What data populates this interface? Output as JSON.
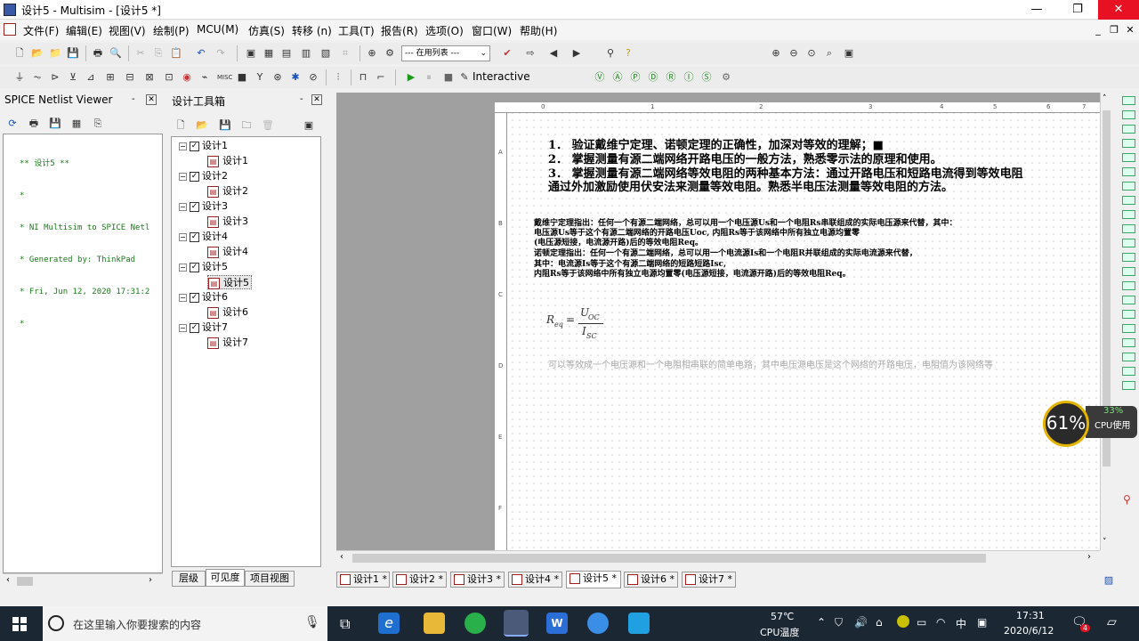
{
  "window": {
    "title": "设计5 - Multisim - [设计5 *]",
    "controls": {
      "minimize": "—",
      "restore": "❐",
      "close": "✕"
    }
  },
  "menu": [
    "文件(F)",
    "编辑(E)",
    "视图(V)",
    "绘制(P)",
    "MCU(M)",
    "仿真(S)",
    "转移 (n)",
    "工具(T)",
    "报告(R)",
    "选项(O)",
    "窗口(W)",
    "帮助(H)"
  ],
  "toolbar": {
    "in_use_list": "--- 在用列表 ---",
    "interactive_label": "Interactive"
  },
  "netlist_viewer": {
    "title": "SPICE Netlist Viewer",
    "lines": [
      "** 设计5 **",
      "*",
      "* NI Multisim to SPICE Netl",
      "* Generated by: ThinkPad",
      "* Fri, Jun 12, 2020 17:31:2",
      "*"
    ]
  },
  "design_toolbox": {
    "title": "设计工具箱",
    "tree": [
      {
        "parent": "设计1",
        "child": "设计1"
      },
      {
        "parent": "设计2",
        "child": "设计2"
      },
      {
        "parent": "设计3",
        "child": "设计3"
      },
      {
        "parent": "设计4",
        "child": "设计4"
      },
      {
        "parent": "设计5",
        "child": "设计5"
      },
      {
        "parent": "设计6",
        "child": "设计6"
      },
      {
        "parent": "设计7",
        "child": "设计7"
      }
    ],
    "tabs": [
      "层级",
      "可见度",
      "项目视图"
    ]
  },
  "sheet": {
    "ruler_top": [
      "0",
      "1",
      "2",
      "3",
      "4",
      "5",
      "6",
      "7"
    ],
    "ruler_left": [
      "A",
      "B",
      "C",
      "D",
      "E",
      "F"
    ],
    "objectives": [
      "1． 验证戴维宁定理、诺顿定理的正确性，加深对等效的理解；■",
      "2． 掌握测量有源二端网络开路电压的一般方法，熟悉零示法的原理和使用。",
      "3． 掌握测量有源二端网络等效电阻的两种基本方法：通过开路电压和短路电流得到等效电阻",
      "通过外加激励使用伏安法来测量等效电阻。熟悉半电压法测量等效电阻的方法。"
    ],
    "theory": [
      "戴维宁定理指出：任何一个有源二端网络，总可以用一个电压源Us和一个电阻Rs串联组成的实际电压源来代替，其中：",
      "电压源Us等于这个有源二端网络的开路电压Uoc, 内阻Rs等于该网络中所有独立电源均置零",
      "(电压源短接，电流源开路)后的等效电阻Req。",
      "诺顿定理指出：任何一个有源二端网络，总可以用一个电流源Is和一个电阻R并联组成的实际电流源来代替，",
      "其中：电流源Is等于这个有源二端网络的短路短路Isc,",
      "内阻Rs等于该网络中所有独立电源均置零(电压源短接，电流源开路)后的等效电阻Req。"
    ],
    "formula": {
      "lhs": "R",
      "lhs_sub": "eq",
      "eq": "=",
      "num": "U",
      "num_sub": "OC",
      "den": "I",
      "den_sub": "SC"
    },
    "faded_note": "可以等效成一个电压源和一个电阻相串联的简单电路，其中电压源电压是这个网络的开路电压，电阻值为该网络等"
  },
  "doc_tabs": [
    "设计1 *",
    "设计2 *",
    "设计3 *",
    "设计4 *",
    "设计5 *",
    "设计6 *",
    "设计7 *"
  ],
  "active_doc_tab": "设计5 *",
  "cpu_monitor": {
    "temp_percent": "61%",
    "cpu_usage": "33%",
    "cpu_label": "CPU使用"
  },
  "taskbar": {
    "search_placeholder": "在这里输入你要搜索的内容",
    "weather_temp": "57℃",
    "weather_label": "CPU温度",
    "ime": "中",
    "time": "17:31",
    "date": "2020/6/12",
    "notification_count": "4"
  },
  "colors": {
    "netlist_text": "#1a7a1a",
    "workspace_bg": "#a0a0a0",
    "taskbar_bg": "#1c2734",
    "gauge_ring": "#e3b400",
    "close_red": "#e81123"
  }
}
